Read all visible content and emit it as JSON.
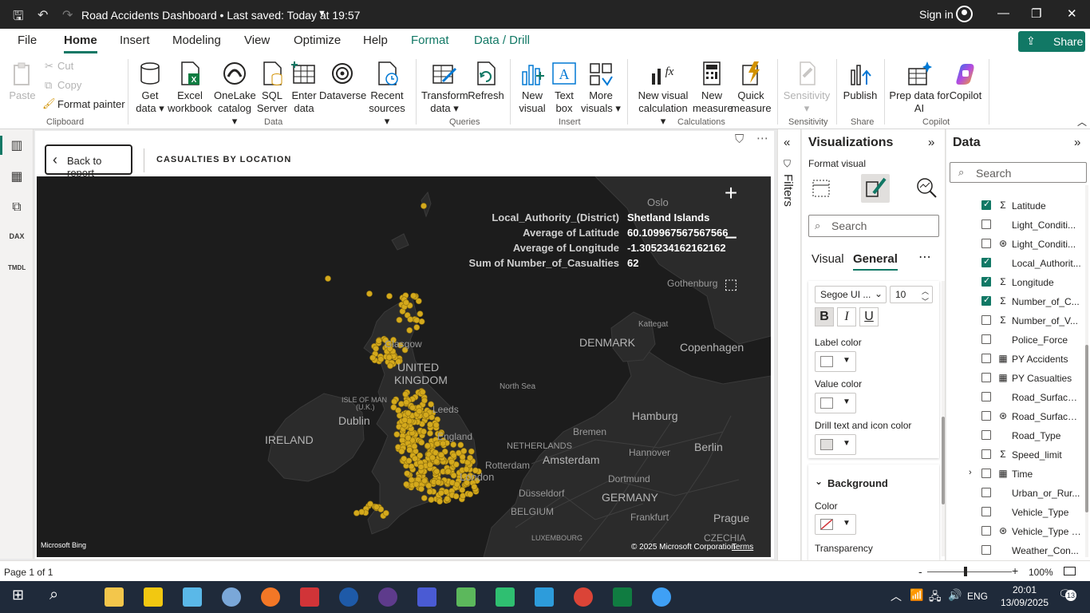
{
  "titlebar": {
    "title": "Road Accidents Dashboard • Last saved: Today at 19:57",
    "sign_in": "Sign in"
  },
  "menu": {
    "tabs": [
      "File",
      "Home",
      "Insert",
      "Modeling",
      "View",
      "Optimize",
      "Help",
      "Format",
      "Data / Drill"
    ],
    "active": "Home",
    "share": "Share"
  },
  "ribbon": {
    "paste": "Paste",
    "cut": "Cut",
    "copy": "Copy",
    "format_painter": "Format painter",
    "clipboard": "Clipboard",
    "get_data": [
      "Get",
      "data"
    ],
    "excel": [
      "Excel",
      "workbook"
    ],
    "onelake": [
      "OneLake",
      "catalog"
    ],
    "sql": [
      "SQL",
      "Server"
    ],
    "enter_data": [
      "Enter",
      "data"
    ],
    "dataverse": "Dataverse",
    "recent": [
      "Recent",
      "sources"
    ],
    "data_group": "Data",
    "transform": [
      "Transform",
      "data"
    ],
    "refresh": "Refresh",
    "queries": "Queries",
    "new_visual": [
      "New",
      "visual"
    ],
    "text_box": [
      "Text",
      "box"
    ],
    "more_visuals": [
      "More",
      "visuals"
    ],
    "insert": "Insert",
    "new_visual_calc": [
      "New visual",
      "calculation"
    ],
    "new_measure": [
      "New",
      "measure"
    ],
    "quick_measure": [
      "Quick",
      "measure"
    ],
    "calculations": "Calculations",
    "sensitivity": "Sensitivity",
    "sensitivity_group": "Sensitivity",
    "publish": "Publish",
    "share_group": "Share",
    "prep_ai": [
      "Prep data for",
      "AI"
    ],
    "copilot": "Copilot",
    "copilot_group": "Copilot"
  },
  "report": {
    "back": "Back to report",
    "visual_title": "CASUALTIES BY LOCATION"
  },
  "tooltip": [
    {
      "key": "Local_Authority_(District)",
      "value": "Shetland Islands"
    },
    {
      "key": "Average of Latitude",
      "value": "60.109967567567566"
    },
    {
      "key": "Average of Longitude",
      "value": "-1.305234162162162"
    },
    {
      "key": "Sum of Number_of_Casualties",
      "value": "62"
    }
  ],
  "map": {
    "labels": {
      "oslo": "Oslo",
      "gothenburg": "Gothenburg",
      "kattegat": "Kattegat",
      "denmark": "DENMARK",
      "copenhagen": "Copenhagen",
      "glasgow": "Glasgow",
      "united": "UNITED",
      "kingdom": "KINGDOM",
      "north_sea": "North Sea",
      "isle_of_man": "ISLE OF MAN",
      "uk": "(U.K.)",
      "leeds": "Leeds",
      "dublin": "Dublin",
      "ireland": "IRELAND",
      "england": "England",
      "london": "London",
      "hamburg": "Hamburg",
      "bremen": "Bremen",
      "netherlands": "NETHERLANDS",
      "hannover": "Hannover",
      "berlin": "Berlin",
      "rotterdam": "Rotterdam",
      "amsterdam": "Amsterdam",
      "dortmund": "Dortmund",
      "germany": "GERMANY",
      "dusseldorf": "Düsseldorf",
      "belgium": "BELGIUM",
      "frankfurt": "Frankfurt",
      "prague": "Prague",
      "luxembourg": "LUXEMBOURG",
      "czechia": "CZECHIA"
    },
    "bing": "Microsoft Bing",
    "copyright": "© 2025 Microsoft Corporation",
    "terms": "Terms",
    "point_color": "#d4a91c"
  },
  "filters": {
    "label": "Filters"
  },
  "viz": {
    "title": "Visualizations",
    "format_visual": "Format visual",
    "search": "Search",
    "tabs": [
      "Visual",
      "General"
    ],
    "font": "Segoe UI ...",
    "font_size": "10",
    "bold": "B",
    "italic": "I",
    "underline": "U",
    "label_color": "Label color",
    "value_color": "Value color",
    "drill_color": "Drill text and icon color",
    "background": "Background",
    "color": "Color",
    "transparency": "Transparency"
  },
  "data_pane": {
    "title": "Data",
    "search": "Search",
    "fields": [
      {
        "name": "Latitude",
        "checked": true,
        "icon": "sigma"
      },
      {
        "name": "Light_Conditi...",
        "checked": false,
        "icon": "none"
      },
      {
        "name": "Light_Conditi...",
        "checked": false,
        "icon": "hierarchy"
      },
      {
        "name": "Local_Authorit...",
        "checked": true,
        "icon": "none"
      },
      {
        "name": "Longitude",
        "checked": true,
        "icon": "sigma"
      },
      {
        "name": "Number_of_C...",
        "checked": true,
        "icon": "sigma"
      },
      {
        "name": "Number_of_V...",
        "checked": false,
        "icon": "sigma"
      },
      {
        "name": "Police_Force",
        "checked": false,
        "icon": "none"
      },
      {
        "name": "PY Accidents",
        "checked": false,
        "icon": "measure"
      },
      {
        "name": "PY Casualties",
        "checked": false,
        "icon": "measure"
      },
      {
        "name": "Road_Surface_...",
        "checked": false,
        "icon": "none"
      },
      {
        "name": "Road_Surface_...",
        "checked": false,
        "icon": "hierarchy"
      },
      {
        "name": "Road_Type",
        "checked": false,
        "icon": "none"
      },
      {
        "name": "Speed_limit",
        "checked": false,
        "icon": "sigma"
      },
      {
        "name": "Time",
        "checked": false,
        "icon": "table"
      },
      {
        "name": "Urban_or_Rur...",
        "checked": false,
        "icon": "none"
      },
      {
        "name": "Vehicle_Type",
        "checked": false,
        "icon": "none"
      },
      {
        "name": "Vehicle_Type (...",
        "checked": false,
        "icon": "hierarchy"
      },
      {
        "name": "Weather_Con...",
        "checked": false,
        "icon": "none"
      }
    ]
  },
  "status": {
    "page": "Page 1 of 1",
    "zoom": "100%"
  },
  "taskbar": {
    "lang": "ENG",
    "time": "20:01",
    "date": "13/09/2025",
    "notifications": "13"
  }
}
